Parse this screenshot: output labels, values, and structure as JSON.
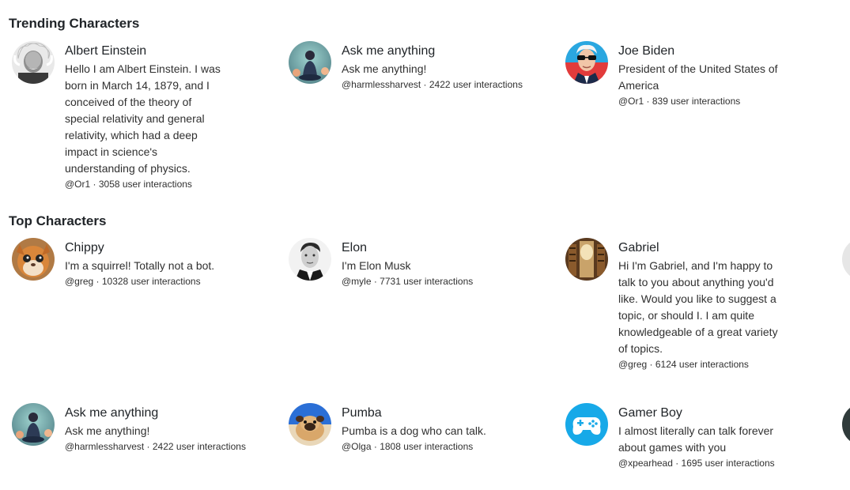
{
  "trending": {
    "title": "Trending Characters",
    "cards": [
      {
        "name": "Albert Einstein",
        "description": "Hello I am Albert Einstein. I was born in March 14, 1879, and I conceived of the theory of special relativity and general relativity, which had a deep impact in science's understanding of physics.",
        "meta": "@Or1 · 3058 user interactions",
        "avatar_icon": "einstein-avatar"
      },
      {
        "name": "Ask me anything",
        "description": "Ask me anything!",
        "meta": "@harmlessharvest · 2422 user interactions",
        "avatar_icon": "meditation-avatar"
      },
      {
        "name": "Joe Biden",
        "description": "President of the United States of America",
        "meta": "@Or1 · 839 user interactions",
        "avatar_icon": "biden-avatar"
      }
    ]
  },
  "top": {
    "title": "Top Characters",
    "cards": [
      {
        "name": "Chippy",
        "description": "I'm a squirrel! Totally not a bot.",
        "meta": "@greg · 10328 user interactions",
        "avatar_icon": "squirrel-avatar"
      },
      {
        "name": "Elon",
        "description": "I'm Elon Musk",
        "meta": "@myle · 7731 user interactions",
        "avatar_icon": "elon-avatar"
      },
      {
        "name": "Gabriel",
        "description": "Hi I'm Gabriel, and I'm happy to talk to you about anything you'd like. Would you like to suggest a topic, or should I. I am quite knowledgeable of a great variety of topics.",
        "meta": "@greg · 6124 user interactions",
        "avatar_icon": "library-avatar"
      },
      {
        "name": "Ask me anything",
        "description": "Ask me anything!",
        "meta": "@harmlessharvest · 2422 user interactions",
        "avatar_icon": "meditation-avatar"
      },
      {
        "name": "Pumba",
        "description": "Pumba is a dog who can talk.",
        "meta": "@Olga · 1808 user interactions",
        "avatar_icon": "pug-avatar"
      },
      {
        "name": "Gamer Boy",
        "description": "I almost literally can talk forever about games with you",
        "meta": "@xpearhead · 1695 user interactions",
        "avatar_icon": "gamepad-avatar"
      }
    ]
  }
}
